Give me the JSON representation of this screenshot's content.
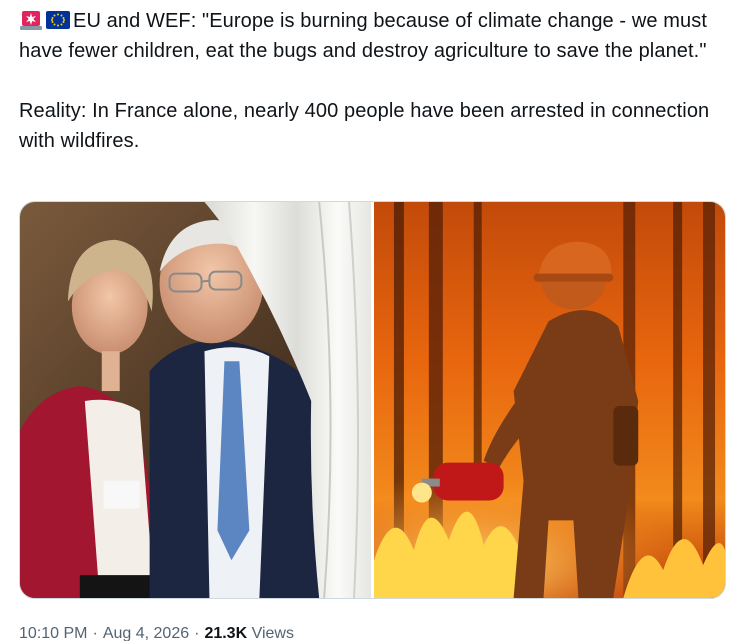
{
  "tweet": {
    "lead_emojis": [
      "siren-emoji",
      "eu-flag-emoji"
    ],
    "line1": "EU and WEF: \"Europe is burning because of climate change - we must have fewer children, eat the bugs and destroy agriculture to save the planet.\"",
    "line2": "Reality: In France alone, nearly 400 people have been arrested in connection with wildfires."
  },
  "media": {
    "images": [
      "photo-two-officials-by-curtain",
      "photo-firefighter-in-wildfire"
    ]
  },
  "meta": {
    "time": "10:10 PM",
    "separator": "·",
    "date": "Aug 4, 2026",
    "views_count": "21.3K",
    "views_label": "Views"
  },
  "colors": {
    "text": "#0f1419",
    "secondary": "#536471",
    "border": "#cfd9de",
    "eu_blue": "#003399",
    "eu_gold": "#ffcc00",
    "siren_red": "#e0245e"
  }
}
